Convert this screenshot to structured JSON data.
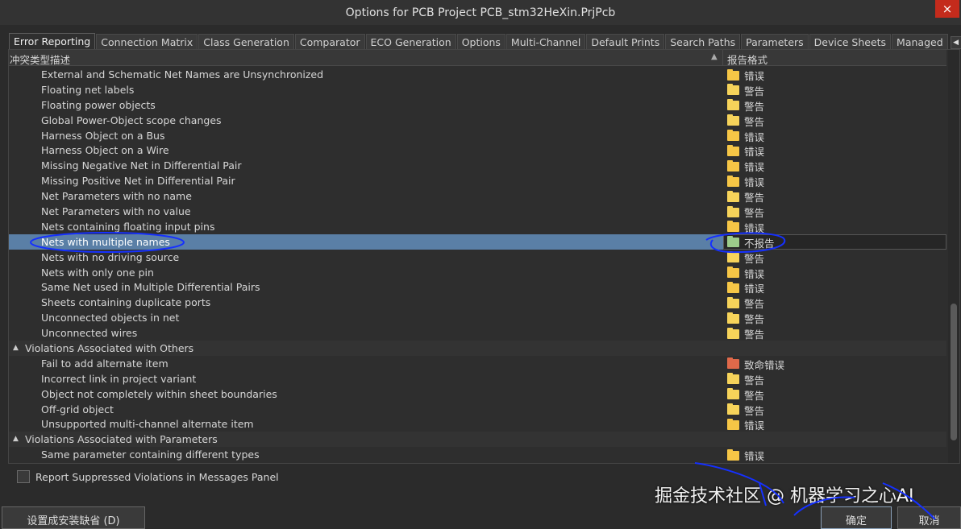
{
  "window": {
    "title": "Options for PCB Project PCB_stm32HeXin.PrjPcb",
    "close_label": "×"
  },
  "tabs": [
    "Error Reporting",
    "Connection Matrix",
    "Class Generation",
    "Comparator",
    "ECO Generation",
    "Options",
    "Multi-Channel",
    "Default Prints",
    "Search Paths",
    "Parameters",
    "Device Sheets",
    "Managed"
  ],
  "tab_arrows": {
    "left": "◀",
    "right": "▶"
  },
  "table": {
    "col_type": "冲突类型描述",
    "col_report": "报告格式",
    "sort_icon": "▲"
  },
  "rows": [
    {
      "name": "External and Schematic Net Names are Unsynchronized",
      "status": "错误",
      "color": "#f6c646"
    },
    {
      "name": "Floating net labels",
      "status": "警告",
      "color": "#f6d35a"
    },
    {
      "name": "Floating power objects",
      "status": "警告",
      "color": "#f6d35a"
    },
    {
      "name": "Global Power-Object scope changes",
      "status": "警告",
      "color": "#f6d35a"
    },
    {
      "name": "Harness Object on a Bus",
      "status": "错误",
      "color": "#f6c646"
    },
    {
      "name": "Harness Object on a Wire",
      "status": "错误",
      "color": "#f6c646"
    },
    {
      "name": "Missing Negative Net in Differential Pair",
      "status": "错误",
      "color": "#f6c646"
    },
    {
      "name": "Missing Positive Net in Differential Pair",
      "status": "错误",
      "color": "#f6c646"
    },
    {
      "name": "Net Parameters with no name",
      "status": "警告",
      "color": "#f6d35a"
    },
    {
      "name": "Net Parameters with no value",
      "status": "警告",
      "color": "#f6d35a"
    },
    {
      "name": "Nets containing floating input pins",
      "status": "错误",
      "color": "#f6c646"
    },
    {
      "name": "Nets with multiple names",
      "status": "不报告",
      "color": "#9ccc8a",
      "selected": true
    },
    {
      "name": "Nets with no driving source",
      "status": "警告",
      "color": "#f6d35a"
    },
    {
      "name": "Nets with only one pin",
      "status": "错误",
      "color": "#f6c646"
    },
    {
      "name": "Same Net used in Multiple Differential Pairs",
      "status": "错误",
      "color": "#f6c646"
    },
    {
      "name": "Sheets containing duplicate ports",
      "status": "警告",
      "color": "#f6d35a"
    },
    {
      "name": "Unconnected objects in net",
      "status": "警告",
      "color": "#f6d35a"
    },
    {
      "name": "Unconnected wires",
      "status": "警告",
      "color": "#f6d35a"
    },
    {
      "name": "Violations Associated with Others",
      "group": true
    },
    {
      "name": "Fail to add alternate item",
      "status": "致命错误",
      "color": "#e0694a"
    },
    {
      "name": "Incorrect link in project variant",
      "status": "警告",
      "color": "#f6d35a"
    },
    {
      "name": "Object not completely within sheet boundaries",
      "status": "警告",
      "color": "#f6d35a"
    },
    {
      "name": "Off-grid object",
      "status": "警告",
      "color": "#f6d35a"
    },
    {
      "name": "Unsupported multi-channel alternate item",
      "status": "错误",
      "color": "#f6c646"
    },
    {
      "name": "Violations Associated with Parameters",
      "group": true
    },
    {
      "name": "Same parameter containing different types",
      "status": "错误",
      "color": "#f6c646"
    }
  ],
  "footer": {
    "report_suppressed": "Report Suppressed Violations in Messages Panel",
    "set_default": "设置成安装缺省 (D)",
    "ok": "确定",
    "cancel": "取消"
  },
  "watermark": "掘金技术社区 @ 机器学习之心AI"
}
